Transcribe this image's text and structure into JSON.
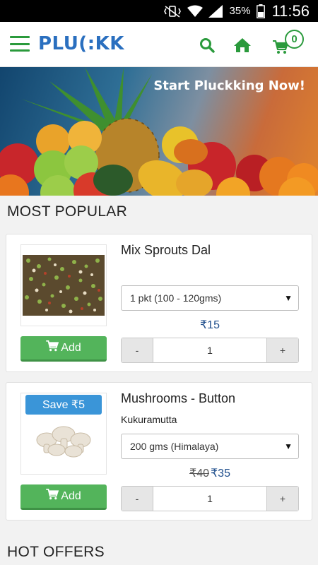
{
  "status_bar": {
    "battery": "35%",
    "time": "11:56",
    "icons": [
      "mute-vibrate-icon",
      "wifi-icon",
      "signal-icon",
      "battery-icon"
    ]
  },
  "header": {
    "logo": "PLU(:KK",
    "cart_count": "0",
    "icons": [
      "menu-icon",
      "search-icon",
      "home-icon",
      "cart-icon"
    ]
  },
  "banner": {
    "tagline": "Start Pluckking Now!"
  },
  "sections": {
    "most_popular": "MOST POPULAR",
    "hot_offers": "HOT OFFERS"
  },
  "products": [
    {
      "name": "Mix Sprouts Dal",
      "variant": "1 pkt (100 - 120gms)",
      "price": "₹15",
      "add_label": "Add",
      "qty_minus": "-",
      "qty": "1",
      "qty_plus": "+"
    },
    {
      "name": "Mushrooms - Button",
      "subtitle": "Kukuramutta",
      "save_badge": "Save ₹5",
      "variant": "200 gms (Himalaya)",
      "old_price": "₹40",
      "price": "₹35",
      "add_label": "Add",
      "qty_minus": "-",
      "qty": "1",
      "qty_plus": "+"
    }
  ],
  "colors": {
    "brand_blue": "#2a6fbf",
    "brand_green": "#2a9a3c",
    "add_button": "#53b45b",
    "save_badge": "#3a95d8",
    "price": "#1f4e8c"
  }
}
